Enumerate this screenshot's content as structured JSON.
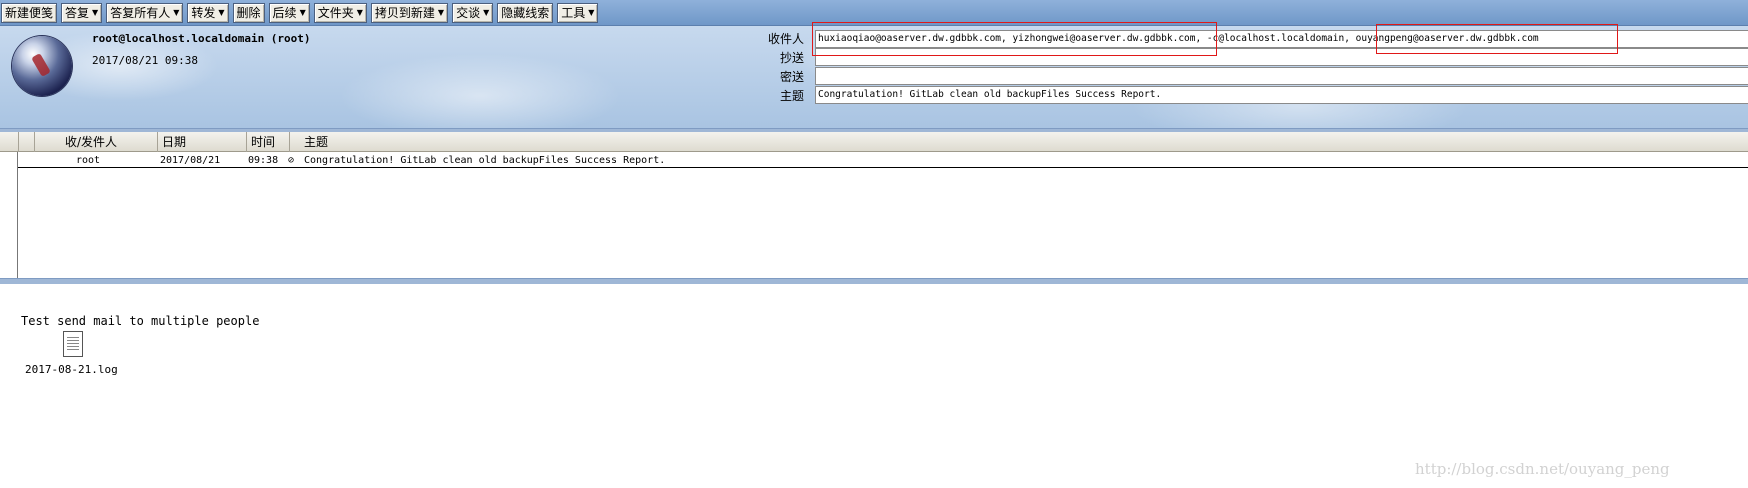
{
  "toolbar": {
    "new_memo": "新建便笺",
    "reply": "答复",
    "reply_all": "答复所有人",
    "forward": "转发",
    "delete": "删除",
    "follow_up": "后续",
    "folder": "文件夹",
    "copy_to_new": "拷贝到新建",
    "chat": "交谈",
    "hide_thread": "隐藏线索",
    "tools": "工具"
  },
  "header": {
    "sender": "root@localhost.localdomain (root)",
    "date": "2017/08/21 09:38",
    "to_label": "收件人",
    "cc_label": "抄送",
    "bcc_label": "密送",
    "subject_label": "主题",
    "to_value": "huxiaoqiao@oaserver.dw.gdbbk.com, yizhongwei@oaserver.dw.gdbbk.com, -c@localhost.localdomain, ouyangpeng@oaserver.dw.gdbbk.com",
    "cc_value": "",
    "bcc_value": "",
    "subject_value": "Congratulation! GitLab clean old backupFiles Success Report."
  },
  "list": {
    "columns": [
      "收/发件人",
      "日期",
      "时间",
      "主题"
    ],
    "rows": [
      {
        "sender": "root",
        "date": "2017/08/21",
        "time": "09:38",
        "subject": "Congratulation! GitLab clean old backupFiles Success Report."
      }
    ]
  },
  "body": {
    "text": "Test send mail to multiple people",
    "attachment_name": "2017-08-21.log"
  },
  "watermark": "http://blog.csdn.net/ouyang_peng",
  "colors": {
    "toolbar": "#7fa3d1",
    "highlight": "#e01818",
    "header_bg": "#b8cfe8"
  }
}
